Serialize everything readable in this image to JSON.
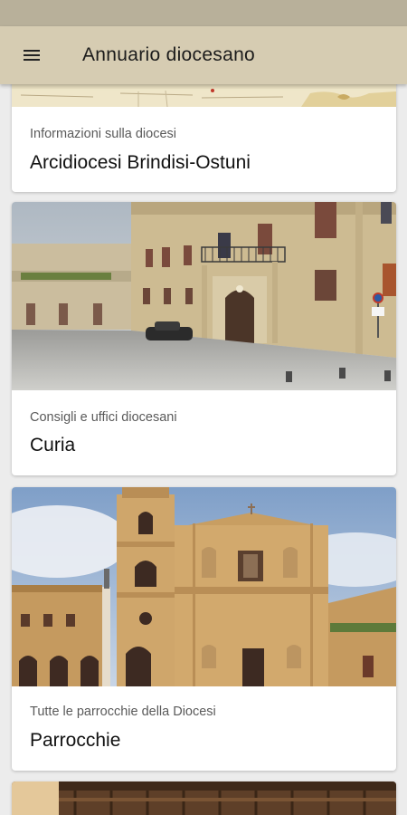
{
  "app_bar": {
    "title": "Annuario diocesano",
    "menu_icon": "hamburger-menu-icon"
  },
  "cards": [
    {
      "subtitle": "Informazioni sulla diocesi",
      "title": "Arcidiocesi Brindisi-Ostuni",
      "image": "map"
    },
    {
      "subtitle": "Consigli e uffici diocesani",
      "title": "Curia",
      "image": "curia-building-photo"
    },
    {
      "subtitle": "Tutte le parrocchie della Diocesi",
      "title": "Parrocchie",
      "image": "cathedral-photo"
    },
    {
      "subtitle": "",
      "title": "",
      "image": "wooden-choir-photo"
    }
  ]
}
